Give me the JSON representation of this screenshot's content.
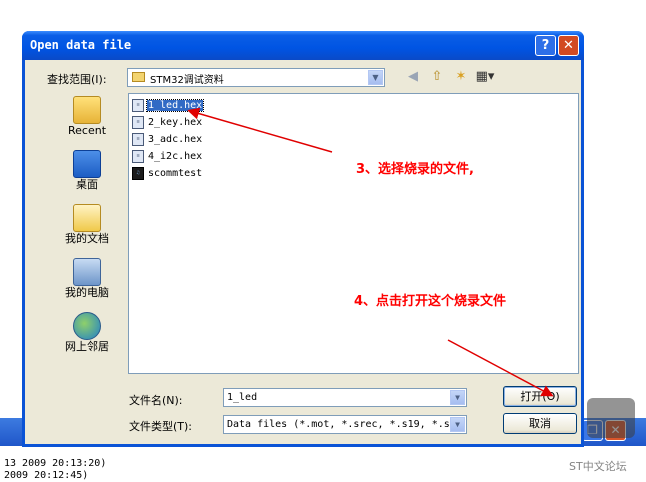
{
  "dialog": {
    "title": "Open data file",
    "help_label": "?",
    "close_label": "✕",
    "lookin_label": "查找范围(I):",
    "lookin_value": "STM32调试资料"
  },
  "places": [
    {
      "label": "Recent",
      "icon": "recent-icon"
    },
    {
      "label": "桌面",
      "icon": "desktop-icon"
    },
    {
      "label": "我的文档",
      "icon": "my-documents-icon"
    },
    {
      "label": "我的电脑",
      "icon": "my-computer-icon"
    },
    {
      "label": "网上邻居",
      "icon": "network-icon"
    }
  ],
  "files": [
    {
      "name": "1_led.hex",
      "selected": true
    },
    {
      "name": "2_key.hex"
    },
    {
      "name": "3_adc.hex"
    },
    {
      "name": "4_i2c.hex"
    },
    {
      "name": "scommtest"
    }
  ],
  "form": {
    "filename_label": "文件名(N):",
    "filename_value": "1_led",
    "filetype_label": "文件类型(T):",
    "filetype_value": "Data files (*.mot, *.srec, *.s19, *.s",
    "open_button": "打开(O)",
    "cancel_button": "取消"
  },
  "annotations": {
    "note1": "3、选择烧录的文件,",
    "note2": "4、点击打开这个烧录文件",
    "color": "#ff0000"
  },
  "background": {
    "log_line1": "13 2009 20:13:20)",
    "log_line2": "2009 20:12:45)",
    "watermark": "ST中文论坛"
  }
}
